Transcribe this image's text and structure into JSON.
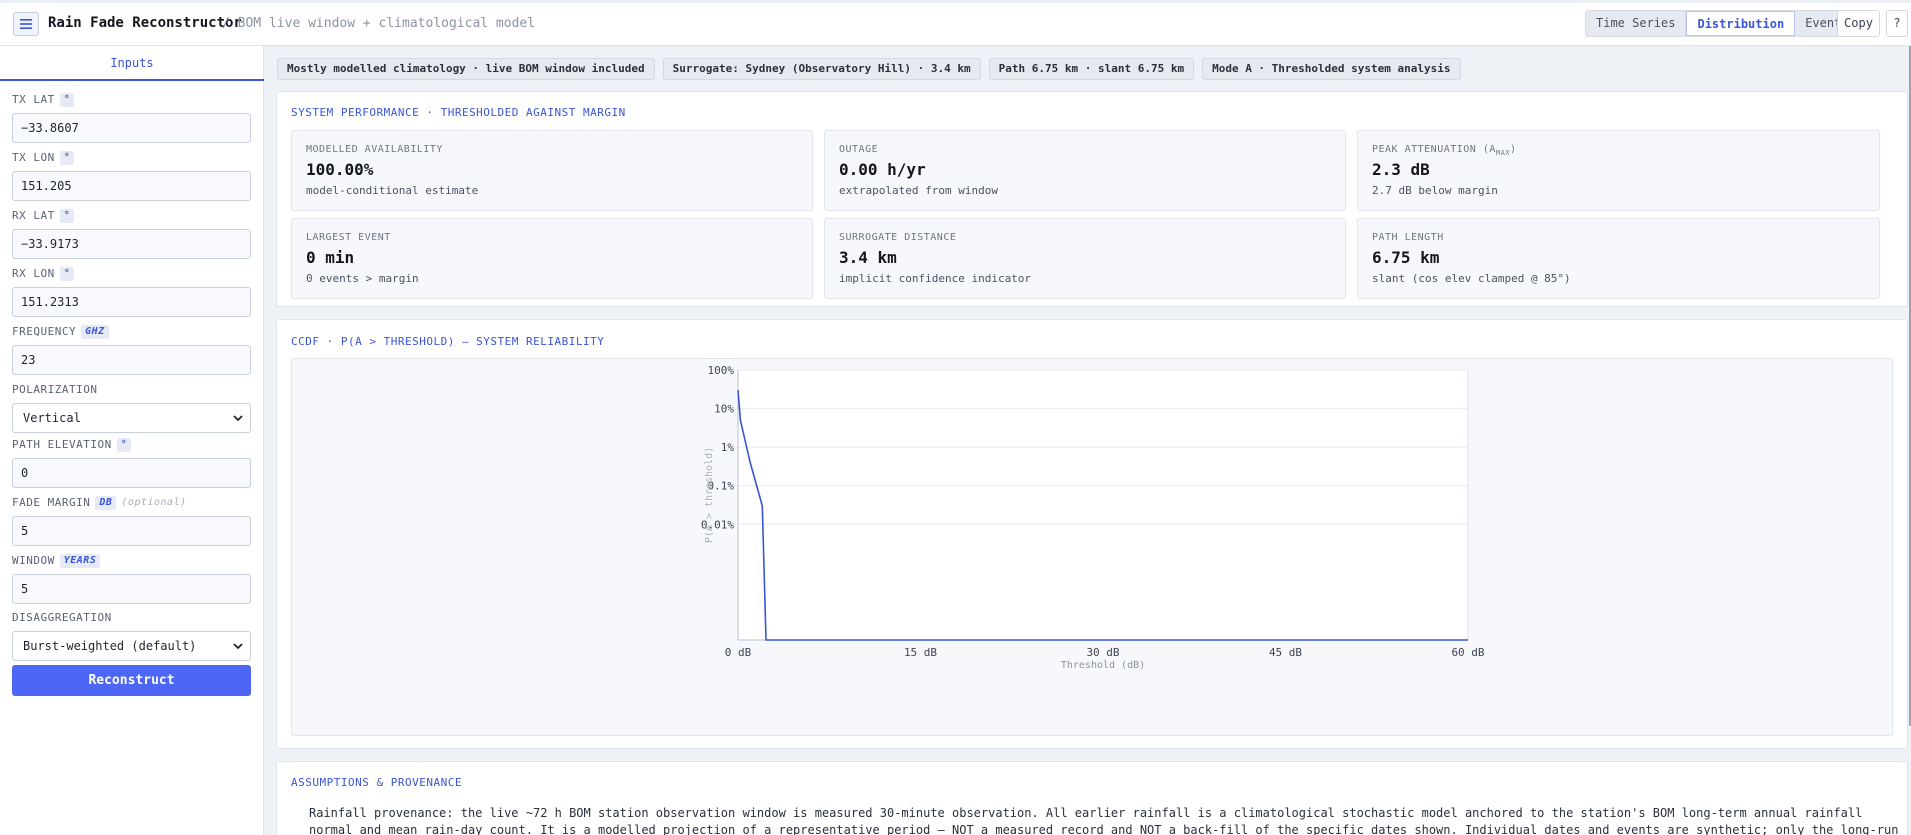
{
  "header": {
    "title": "Rain Fade Reconstructor",
    "subtitle": "/ BOM live window + climatological model",
    "tabs": [
      "Time Series",
      "Distribution",
      "Events"
    ],
    "active_tab": "Distribution",
    "copy_label": "Copy",
    "help_label": "?"
  },
  "sidebar": {
    "tab_label": "Inputs",
    "fields": [
      {
        "label": "TX LAT",
        "unit": "°",
        "value": "−33.8607",
        "type": "input"
      },
      {
        "label": "TX LON",
        "unit": "°",
        "value": "151.205",
        "type": "input"
      },
      {
        "label": "RX LAT",
        "unit": "°",
        "value": "−33.9173",
        "type": "input"
      },
      {
        "label": "RX LON",
        "unit": "°",
        "value": "151.2313",
        "type": "input"
      },
      {
        "label": "FREQUENCY",
        "unit": "GHZ",
        "value": "23",
        "type": "input"
      },
      {
        "label": "POLARIZATION",
        "unit": "",
        "value": "Vertical",
        "type": "select"
      },
      {
        "label": "PATH ELEVATION",
        "unit": "°",
        "value": "0",
        "type": "input"
      },
      {
        "label": "FADE MARGIN",
        "unit": "DB",
        "optional": "(optional)",
        "value": "5",
        "type": "input"
      },
      {
        "label": "WINDOW",
        "unit": "YEARS",
        "value": "5",
        "type": "input"
      },
      {
        "label": "DISAGGREGATION",
        "unit": "",
        "value": "Burst-weighted (default)",
        "type": "select"
      }
    ],
    "button_label": "Reconstruct"
  },
  "badges": [
    "Mostly modelled climatology · live BOM window included",
    "Surrogate: Sydney (Observatory Hill) · 3.4 km",
    "Path 6.75 km · slant 6.75 km",
    "Mode A · Thresholded system analysis"
  ],
  "performance": {
    "title": "SYSTEM PERFORMANCE · THRESHOLDED AGAINST MARGIN",
    "cards": [
      {
        "label": "MODELLED AVAILABILITY",
        "value": "100.00%",
        "note": "model-conditional estimate"
      },
      {
        "label": "OUTAGE",
        "value": "0.00 h/yr",
        "note": "extrapolated from window"
      },
      {
        "label": "PEAK ATTENUATION (A",
        "label_sub": "MAX",
        "label_end": ")",
        "value": "2.3 dB",
        "note": "2.7 dB below margin"
      },
      {
        "label": "LARGEST EVENT",
        "value": "0 min",
        "note": "0 events > margin"
      },
      {
        "label": "SURROGATE DISTANCE",
        "value": "3.4 km",
        "note": "implicit confidence indicator"
      },
      {
        "label": "PATH LENGTH",
        "value": "6.75 km",
        "note": "slant (cos elev clamped @ 85°)"
      }
    ]
  },
  "ccdf": {
    "title": "CCDF · P(A > THRESHOLD) — SYSTEM RELIABILITY"
  },
  "chart_data": {
    "type": "line",
    "xlabel": "Threshold (dB)",
    "ylabel": "P(A > threshold)",
    "xlim": [
      0,
      60
    ],
    "y_scale": "log",
    "ylim": [
      1e-05,
      100
    ],
    "x_ticks": [
      "0 dB",
      "15 dB",
      "30 dB",
      "45 dB",
      "60 dB"
    ],
    "x_tick_values": [
      0,
      15,
      30,
      45,
      60
    ],
    "y_ticks": [
      "100%",
      "10%",
      "1%",
      "0.1%",
      "0.01%"
    ],
    "y_tick_values": [
      100,
      10,
      1,
      0.1,
      0.01
    ],
    "grid": true,
    "series": [
      {
        "x": [
          0,
          0.2,
          1.0,
          2.0,
          2.3,
          2.5,
          60
        ],
        "y": [
          30,
          5,
          0.4,
          0.03,
          1e-05,
          1e-05,
          1e-05
        ],
        "color": "#3a55d6"
      }
    ]
  },
  "provenance": {
    "title": "ASSUMPTIONS & PROVENANCE",
    "text": "Rainfall provenance: the live ~72 h BOM station observation window is measured 30-minute observation. All earlier rainfall is a climatological stochastic model anchored to the station's BOM long-term annual rainfall normal and mean rain-day count. It is a modelled projection of a representative period — NOT a measured record and NOT a back-fill of the specific dates shown. Individual dates and events are synthetic; only the long-run rainfall statistics are anchored to real climatology."
  },
  "colors": {
    "accent": "#3a55d6",
    "button": "#4d66f5"
  }
}
